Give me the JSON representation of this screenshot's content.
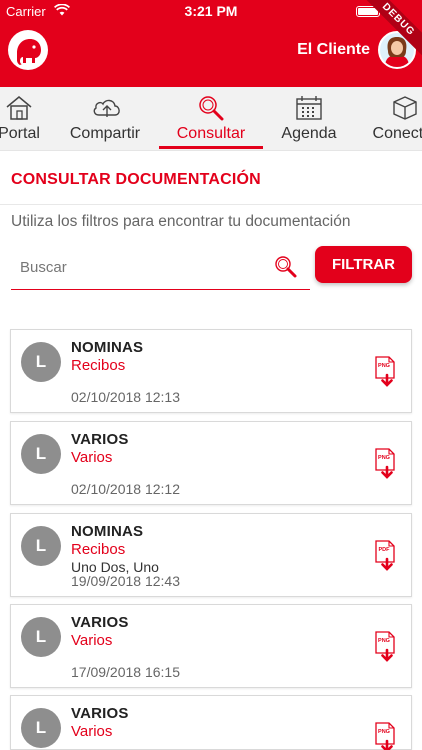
{
  "status_bar": {
    "carrier": "Carrier",
    "time": "3:21 PM"
  },
  "header": {
    "user_name": "El Cliente",
    "debug_label": "DEBUG"
  },
  "tabs": [
    {
      "label": "Portal",
      "icon": "home-icon"
    },
    {
      "label": "Compartir",
      "icon": "cloud-upload-icon"
    },
    {
      "label": "Consultar",
      "icon": "search-icon",
      "active": true
    },
    {
      "label": "Agenda",
      "icon": "calendar-icon"
    },
    {
      "label": "Conectar",
      "icon": "cube-icon"
    }
  ],
  "section": {
    "title": "CONSULTAR DOCUMENTACIÓN",
    "hint": "Utiliza los filtros para encontrar tu documentación"
  },
  "search": {
    "placeholder": "Buscar",
    "value": "",
    "button_label": "FILTRAR"
  },
  "documents": [
    {
      "initial": "L",
      "title": "NOMINAS",
      "category": "Recibos",
      "description": "",
      "date": "02/10/2018 12:13",
      "file_type": "PNG"
    },
    {
      "initial": "L",
      "title": "VARIOS",
      "category": "Varios",
      "description": "",
      "date": "02/10/2018 12:12",
      "file_type": "PNG"
    },
    {
      "initial": "L",
      "title": "NOMINAS",
      "category": "Recibos",
      "description": "Uno Dos, Uno",
      "date": "19/09/2018 12:43",
      "file_type": "PDF"
    },
    {
      "initial": "L",
      "title": "VARIOS",
      "category": "Varios",
      "description": "",
      "date": "17/09/2018 16:15",
      "file_type": "PNG"
    },
    {
      "initial": "L",
      "title": "VARIOS",
      "category": "Varios",
      "description": "",
      "date": "",
      "file_type": "PNG"
    }
  ],
  "colors": {
    "brand": "#e3001b",
    "avatar_gray": "#8e8e8e"
  }
}
